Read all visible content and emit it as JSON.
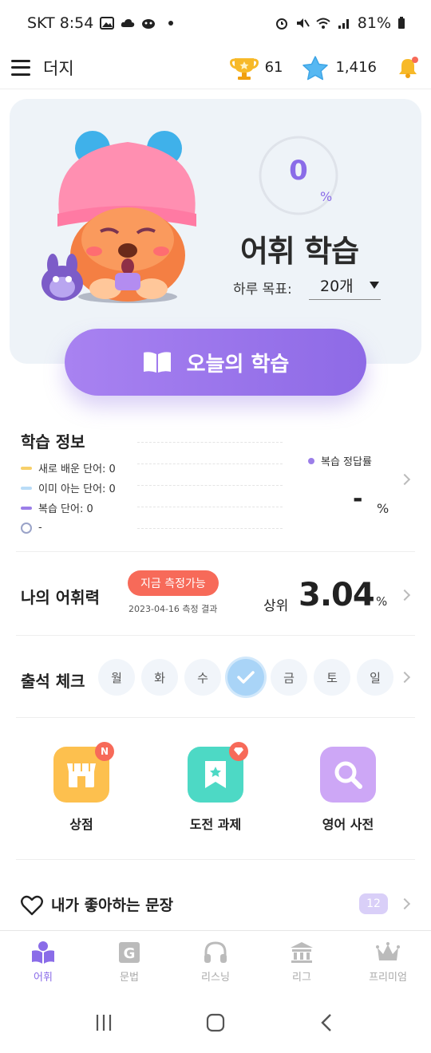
{
  "status_bar": {
    "carrier_time": "SKT 8:54",
    "battery": "81%"
  },
  "header": {
    "title": "더지",
    "trophies": "61",
    "stars": "1,416"
  },
  "hero": {
    "progress_value": "0",
    "progress_unit": "%",
    "progress_fraction": 0,
    "title": "어휘 학습",
    "goal_label": "하루 목표:",
    "goal_value": "20개"
  },
  "start_button": {
    "label": "오늘의 학습"
  },
  "learning_info": {
    "title": "학습 정보",
    "legend": [
      {
        "label": "새로 배운 단어: 0",
        "color": "#f7d06a"
      },
      {
        "label": "이미 아는 단어: 0",
        "color": "#b9dcf7"
      },
      {
        "label": "복습 단어: 0",
        "color": "#9b7ee8"
      }
    ],
    "time_label": "-",
    "review_legend": "복습 정답률",
    "review_value": "-",
    "review_unit": "%"
  },
  "vocab_level": {
    "title": "나의 어휘력",
    "badge": "지금 측정가능",
    "date": "2023-04-16 측정 결과",
    "rank_label": "상위",
    "rank_value": "3.04",
    "rank_unit": "%"
  },
  "attendance": {
    "title": "출석 체크",
    "days": [
      {
        "label": "월",
        "checked": false
      },
      {
        "label": "화",
        "checked": false
      },
      {
        "label": "수",
        "checked": false
      },
      {
        "label": "목",
        "checked": true
      },
      {
        "label": "금",
        "checked": false
      },
      {
        "label": "토",
        "checked": false
      },
      {
        "label": "일",
        "checked": false
      }
    ]
  },
  "shortcuts": [
    {
      "label": "상점",
      "icon": "shop-icon",
      "color": "#fdc04e",
      "badge": "N"
    },
    {
      "label": "도전 과제",
      "icon": "bookmark-star-icon",
      "color": "#4dd9c5",
      "badge": ""
    },
    {
      "label": "영어 사전",
      "icon": "search-icon",
      "color": "#cda7f6",
      "badge": ""
    }
  ],
  "favorites": {
    "title": "내가 좋아하는 문장",
    "count": "12"
  },
  "bottom_nav": [
    {
      "label": "어휘",
      "icon": "book-person-icon",
      "active": true
    },
    {
      "label": "문법",
      "icon": "grammar-g-icon",
      "active": false
    },
    {
      "label": "리스닝",
      "icon": "headphones-icon",
      "active": false
    },
    {
      "label": "리그",
      "icon": "league-building-icon",
      "active": false
    },
    {
      "label": "프리미엄",
      "icon": "crown-icon",
      "active": false
    }
  ],
  "colors": {
    "accent": "#8a6ce8",
    "badge_red": "#f76a59"
  }
}
